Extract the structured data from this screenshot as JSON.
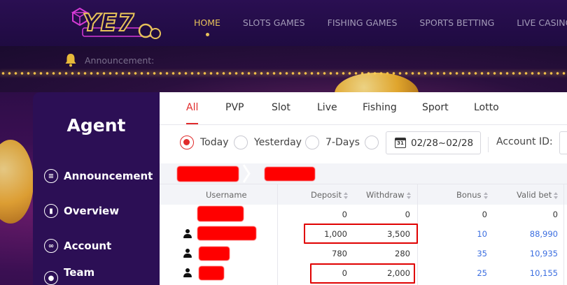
{
  "topnav": {
    "logo_text": "YE7",
    "items": [
      {
        "label": "HOME",
        "active": true
      },
      {
        "label": "SLOTS GAMES",
        "active": false
      },
      {
        "label": "FISHING GAMES",
        "active": false
      },
      {
        "label": "SPORTS BETTING",
        "active": false
      },
      {
        "label": "LIVE CASINO",
        "active": false
      }
    ]
  },
  "announcement": {
    "label": "Announcement:"
  },
  "sidebar": {
    "title": "Agent",
    "items": [
      {
        "label": "Announcement",
        "icon": "list-icon"
      },
      {
        "label": "Overview",
        "icon": "bar-chart-icon"
      },
      {
        "label": "Account",
        "icon": "link-icon"
      },
      {
        "label": "Team",
        "icon": "user-icon"
      }
    ]
  },
  "tabs": [
    {
      "label": "All",
      "active": true
    },
    {
      "label": "PVP",
      "active": false
    },
    {
      "label": "Slot",
      "active": false
    },
    {
      "label": "Live",
      "active": false
    },
    {
      "label": "Fishing",
      "active": false
    },
    {
      "label": "Sport",
      "active": false
    },
    {
      "label": "Lotto",
      "active": false
    }
  ],
  "filters": {
    "periods": [
      {
        "label": "Today",
        "checked": true
      },
      {
        "label": "Yesterday",
        "checked": false
      },
      {
        "label": "7-Days",
        "checked": false
      },
      {
        "label": "",
        "checked": false
      }
    ],
    "date_range": "02/28~02/28",
    "calendar_day": "31",
    "account_id_label": "Account ID:"
  },
  "table": {
    "headers": {
      "username": "Username",
      "deposit": "Deposit",
      "withdraw": "Withdraw",
      "bonus": "Bonus",
      "valid_bet": "Valid bet"
    },
    "rows": [
      {
        "has_user_icon": false,
        "deposit": "0",
        "withdraw": "0",
        "bonus": "0",
        "valid_bet": "0",
        "link_values": false
      },
      {
        "has_user_icon": true,
        "deposit": "1,000",
        "withdraw": "3,500",
        "bonus": "10",
        "valid_bet": "88,990",
        "link_values": true
      },
      {
        "has_user_icon": true,
        "deposit": "780",
        "withdraw": "280",
        "bonus": "35",
        "valid_bet": "10,935",
        "link_values": true
      },
      {
        "has_user_icon": true,
        "deposit": "0",
        "withdraw": "2,000",
        "bonus": "25",
        "valid_bet": "10,155",
        "link_values": true
      }
    ]
  },
  "colors": {
    "accent_red": "#e02b2b",
    "nav_gold": "#e7c25a",
    "sidebar_bg": "#2c0f55",
    "link_blue": "#3b6ee0",
    "redaction": "#ff0000"
  }
}
